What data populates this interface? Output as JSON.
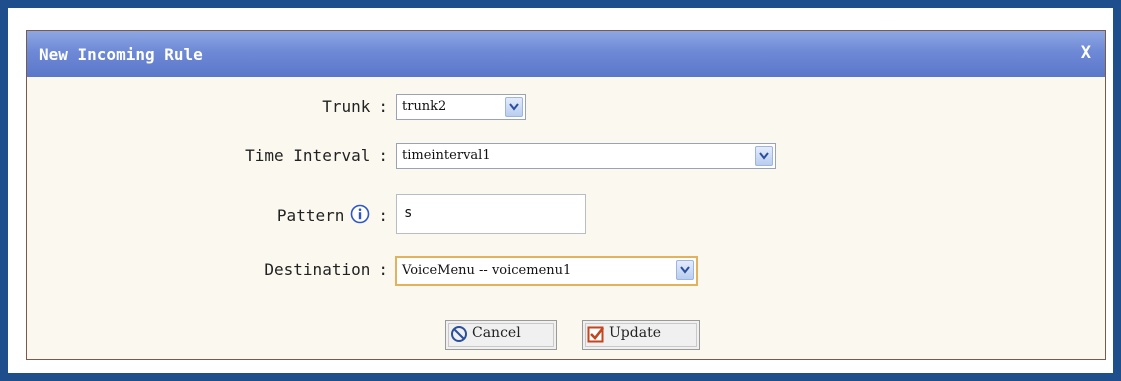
{
  "dialog": {
    "title": "New Incoming Rule",
    "close_label": "X"
  },
  "form": {
    "trunk": {
      "label": "Trunk",
      "colon": ":",
      "value": "trunk2"
    },
    "time_interval": {
      "label": "Time Interval",
      "colon": ":",
      "value": "timeinterval1"
    },
    "pattern": {
      "label": "Pattern",
      "colon": ":",
      "value": "s"
    },
    "destination": {
      "label": "Destination",
      "colon": ":",
      "value": "VoiceMenu -- voicemenu1"
    }
  },
  "buttons": {
    "cancel": "Cancel",
    "update": "Update"
  },
  "icons": {
    "info": "info-icon",
    "cancel": "prohibited-icon",
    "update": "checkbox-checked-icon",
    "dropdown": "chevron-down-icon"
  },
  "colors": {
    "titlebar": "#6e89d6",
    "dialog_bg": "#fbf8f0",
    "frame": "#1f4e8c",
    "focus_border": "#e2b35a"
  }
}
